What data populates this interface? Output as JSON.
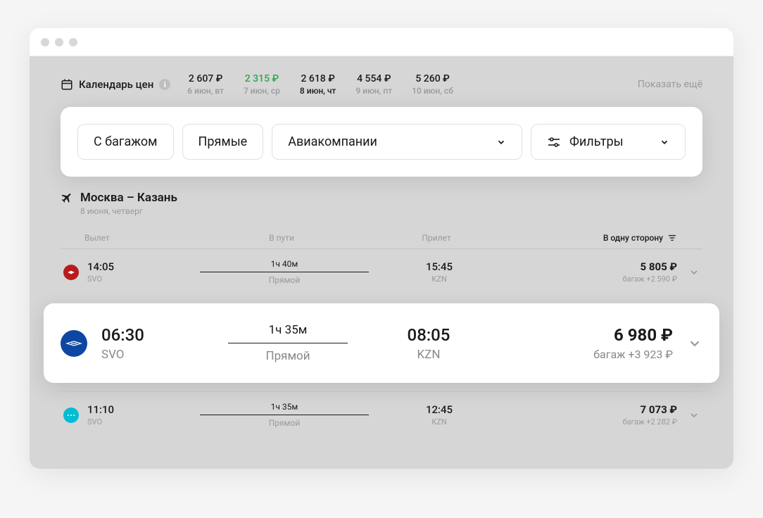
{
  "calendar": {
    "label": "Календарь цен",
    "days": [
      {
        "price": "2 607 ₽",
        "date": "6 июн, вт",
        "cheap": false,
        "selected": false
      },
      {
        "price": "2 315 ₽",
        "date": "7 июн, ср",
        "cheap": true,
        "selected": false
      },
      {
        "price": "2 618 ₽",
        "date": "8 июн, чт",
        "cheap": false,
        "selected": true
      },
      {
        "price": "4 554 ₽",
        "date": "9 июн, пт",
        "cheap": false,
        "selected": false
      },
      {
        "price": "5 260 ₽",
        "date": "10 июн, сб",
        "cheap": false,
        "selected": false
      }
    ],
    "show_more": "Показать ещё"
  },
  "filters": {
    "baggage": "С багажом",
    "direct": "Прямые",
    "airlines": "Авиакомпании",
    "filters": "Фильтры"
  },
  "route": {
    "title": "Москва – Казань",
    "date": "8 июня, четверг"
  },
  "columns": {
    "depart": "Вылет",
    "path": "В пути",
    "arrive": "Прилет",
    "sort": "В одну сторону"
  },
  "flights": [
    {
      "logo": "nordwind",
      "depart_time": "14:05",
      "depart_code": "SVO",
      "duration": "1ч 40м",
      "type": "Прямой",
      "arrive_time": "15:45",
      "arrive_code": "KZN",
      "price": "5 805 ₽",
      "baggage": "багаж +2 590 ₽",
      "highlighted": false
    },
    {
      "logo": "aeroflot",
      "depart_time": "06:30",
      "depart_code": "SVO",
      "duration": "1ч 35м",
      "type": "Прямой",
      "arrive_time": "08:05",
      "arrive_code": "KZN",
      "price": "6 980 ₽",
      "baggage": "багаж +3 923 ₽",
      "highlighted": true
    },
    {
      "logo": "pobeda",
      "depart_time": "11:10",
      "depart_code": "SVO",
      "duration": "1ч 35м",
      "type": "Прямой",
      "arrive_time": "12:45",
      "arrive_code": "KZN",
      "price": "7 073 ₽",
      "baggage": "багаж +2 282 ₽",
      "highlighted": false
    }
  ]
}
